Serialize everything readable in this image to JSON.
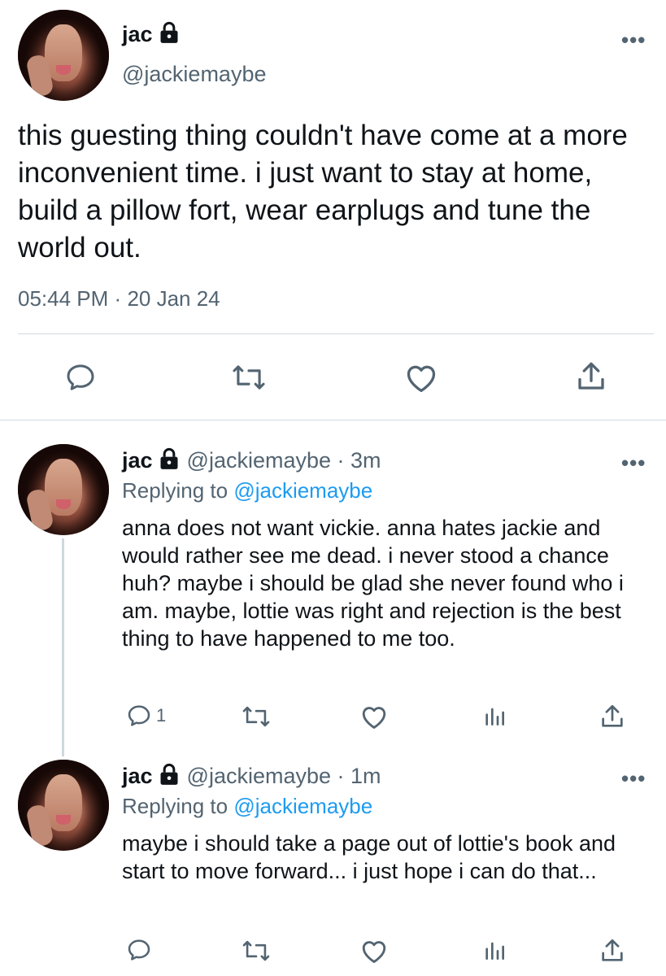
{
  "tweet": {
    "name": "jac",
    "handle": "@jackiemaybe",
    "text": "this guesting thing couldn't have come at a more inconvenient time. i just want to stay at home, build a pillow fort, wear earplugs and tune the world out.",
    "time": "05:44 PM",
    "separator": "·",
    "date": "20 Jan 24",
    "more": "•••"
  },
  "replies": [
    {
      "name": "jac",
      "meta": "@jackiemaybe · 3m",
      "replying_prefix": "Replying to",
      "replying_handle": "@jackiemaybe",
      "text": "anna does not want vickie. anna hates jackie and would rather see me dead. i never stood a chance huh? maybe i should be glad she never found who i am. maybe, lottie was right and rejection is the best thing to have happened to me too.",
      "reply_count": "1",
      "more": "•••"
    },
    {
      "name": "jac",
      "meta": "@jackiemaybe · 1m",
      "replying_prefix": "Replying to",
      "replying_handle": "@jackiemaybe",
      "text": "maybe i should take a page out of lottie's book and start to move forward... i just hope i can do that...",
      "reply_count": "",
      "more": "•••"
    }
  ],
  "icons": {
    "reply": "speech-bubble-icon",
    "retweet": "retweet-icon",
    "like": "heart-icon",
    "share": "share-icon",
    "analytics": "analytics-icon",
    "lock": "lock-icon"
  },
  "colors": {
    "text": "#0f1419",
    "secondary": "#536471",
    "link": "#1d9bf0",
    "divider": "#cfd9de"
  }
}
